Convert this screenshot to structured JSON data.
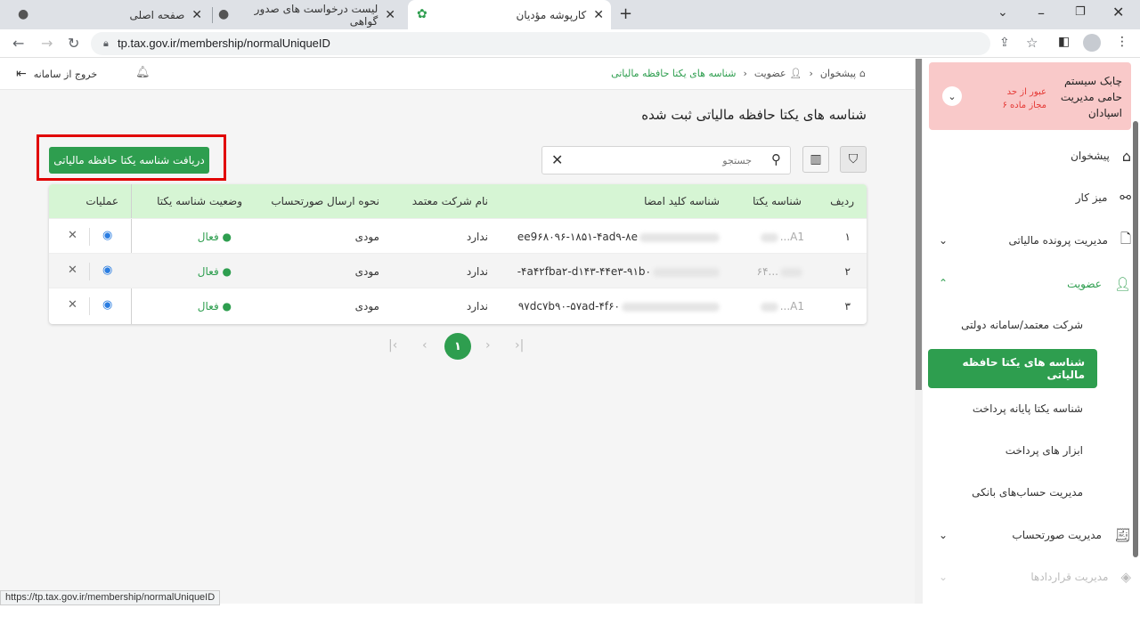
{
  "browser": {
    "tabs": [
      {
        "title": "صفحه اصلی"
      },
      {
        "title": "لیست درخواست های صدور گواهی"
      },
      {
        "title": "کارپوشه مؤدیان"
      }
    ],
    "url": "tp.tax.gov.ir/membership/normalUniqueID",
    "status_url": "https://tp.tax.gov.ir/membership/normalUniqueID"
  },
  "topbar": {
    "logout": "خروج از سامانه",
    "breadcrumb": [
      "پیشخوان",
      "عضویت",
      "شناسه های یکتا حافظه مالیاتی"
    ]
  },
  "page": {
    "title": "شناسه های یکتا حافظه مالیاتی ثبت شده",
    "get_button": "دریافت شناسه یکتا حافظه مالیاتی",
    "search_placeholder": "جستجو"
  },
  "table": {
    "headers": {
      "row": "ردیف",
      "unique_id": "شناسه یکتا",
      "key_id": "شناسه کلید امضا",
      "company": "نام شرکت معتمد",
      "method": "نحوه ارسال صورتحساب",
      "status": "وضعیت شناسه یکتا",
      "ops": "عملیات"
    },
    "rows": [
      {
        "row": "۱",
        "unique_id": "A1...",
        "key_id": "ee9۶۸۰۹۶-۱۸۵۱-۴ad۹-۸e",
        "company": "ندارد",
        "method": "مودی",
        "status": "فعال"
      },
      {
        "row": "۲",
        "unique_id": "...۶۴",
        "key_id": "۴a۴۲fba۲-d۱۴۳-۴۴e۳-۹۱b۰-",
        "company": "ندارد",
        "method": "مودی",
        "status": "فعال"
      },
      {
        "row": "۳",
        "unique_id": "A1...",
        "key_id": "۹۷dc۷b۹۰-۵۷ad-۴f۶۰",
        "company": "ندارد",
        "method": "مودی",
        "status": "فعال"
      }
    ]
  },
  "pagination": {
    "current": "۱"
  },
  "sidebar": {
    "alert_title": "چابک سیستم حامی مدیریت اسپادان",
    "alert_sub": "عبور از حد مجاز ماده ۶",
    "items": [
      {
        "label": "پیشخوان"
      },
      {
        "label": "میز کار"
      },
      {
        "label": "مدیریت پرونده مالیاتی"
      },
      {
        "label": "عضویت"
      },
      {
        "label": "مدیریت صورتحساب"
      },
      {
        "label": "مدیریت قراردادها"
      }
    ],
    "subitems": [
      {
        "label": "شرکت معتمد/سامانه دولتی"
      },
      {
        "label": "شناسه های یکتا حافظه مالیاتی"
      },
      {
        "label": "شناسه یکتا پایانه پرداخت"
      },
      {
        "label": "ابزار های پرداخت"
      },
      {
        "label": "مدیریت حساب‌های بانکی"
      }
    ]
  },
  "colors": {
    "accent": "#2e9e4f",
    "header_bg": "#d6f5d4",
    "alert_bg": "#f9c9c9",
    "highlight": "#e10000"
  }
}
